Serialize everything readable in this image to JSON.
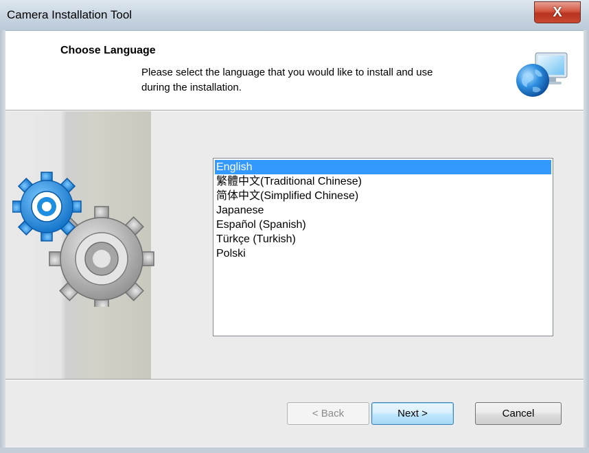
{
  "window": {
    "title": "Camera Installation Tool",
    "close_glyph": "X"
  },
  "header": {
    "title": "Choose Language",
    "subtitle": "Please select the language that you would like to install and use during the installation.",
    "icon": "globe-computer-icon"
  },
  "side_panel": {
    "icon": "gears-icon"
  },
  "languages": {
    "selected": "English",
    "items": [
      {
        "label": "English"
      },
      {
        "label": "繁體中文(Traditional Chinese)"
      },
      {
        "label": "简体中文(Simplified Chinese)"
      },
      {
        "label": "Japanese"
      },
      {
        "label": "Español (Spanish)"
      },
      {
        "label": "Türkçe (Turkish)"
      },
      {
        "label": "Polski"
      }
    ]
  },
  "buttons": {
    "back": "< Back",
    "next": "Next >",
    "cancel": "Cancel"
  },
  "colors": {
    "selection": "#3399ff",
    "close": "#c9492f",
    "gear_blue": "#1e8fe0",
    "gear_gray": "#9a9a9a"
  }
}
